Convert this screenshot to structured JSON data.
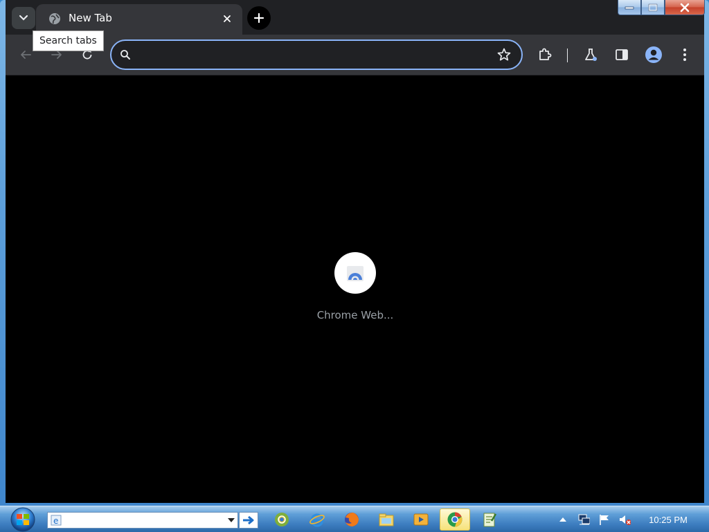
{
  "window": {
    "controls": [
      "minimize",
      "maximize",
      "close"
    ]
  },
  "tab_strip": {
    "search_icon": "chevron-down-icon",
    "active_tab": {
      "title": "New Tab",
      "favicon": "globe-icon",
      "close_icon": "close-icon"
    },
    "new_tab_icon": "plus-icon"
  },
  "tooltip": {
    "text": "Search tabs"
  },
  "toolbar": {
    "omnibox": {
      "value": "",
      "placeholder": ""
    },
    "icons": [
      "back-arrow-icon",
      "forward-arrow-icon",
      "reload-icon",
      "search-icon",
      "star-icon",
      "extensions-puzzle-icon",
      "labs-flask-icon",
      "side-panel-icon",
      "profile-avatar-icon",
      "kebab-menu-icon"
    ]
  },
  "content": {
    "app_tile_label": "Chrome Web...",
    "app_tile_icon": "chrome-web-store-icon"
  },
  "taskbar": {
    "address_value": "",
    "clock": "10:25 PM",
    "apps": [
      "chrome-icon",
      "internet-explorer-icon",
      "firefox-icon",
      "file-explorer-icon",
      "media-player-icon",
      "chrome-icon",
      "notepad-icon"
    ],
    "tray": [
      "show-hidden-icons",
      "network-icon",
      "action-center-flag-icon",
      "volume-muted-icon"
    ]
  },
  "colors": {
    "chrome_frame": "#202124",
    "toolbar": "#35363a",
    "omnibox_border": "#8ab4f8",
    "content_bg": "#000000",
    "label_gray": "#9aa0a6"
  }
}
